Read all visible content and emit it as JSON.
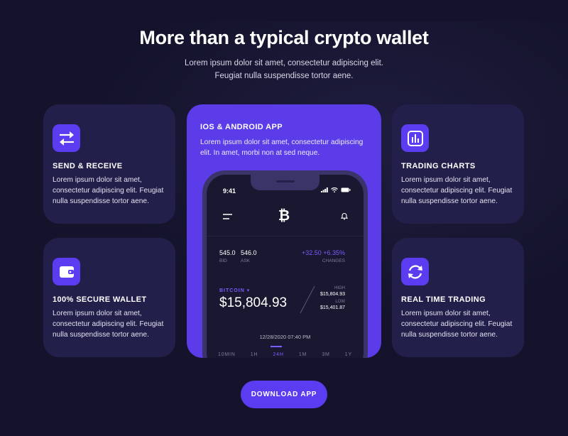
{
  "header": {
    "title": "More than a typical crypto wallet",
    "subtitle_line1": "Lorem ipsum dolor sit amet, consectetur adipiscing elit.",
    "subtitle_line2": "Feugiat nulla suspendisse tortor aene."
  },
  "features": {
    "send_receive": {
      "icon": "transfer-arrows-icon",
      "title": "SEND & RECEIVE",
      "text": "Lorem ipsum dolor sit amet, consectetur adipiscing elit. Feugiat nulla suspendisse tortor aene."
    },
    "secure_wallet": {
      "icon": "wallet-icon",
      "title": "100% SECURE WALLET",
      "text": "Lorem ipsum dolor sit amet, consectetur adipiscing elit. Feugiat nulla suspendisse tortor aene."
    },
    "trading_charts": {
      "icon": "bar-chart-icon",
      "title": "TRADING CHARTS",
      "text": "Lorem ipsum dolor sit amet, consectetur adipiscing elit. Feugiat nulla suspendisse tortor aene."
    },
    "real_time": {
      "icon": "refresh-icon",
      "title": "REAL TIME TRADING",
      "text": "Lorem ipsum dolor sit amet, consectetur adipiscing elit. Feugiat nulla suspendisse tortor aene."
    }
  },
  "app_card": {
    "title": "IOS & ANDROID APP",
    "text": "Lorem ipsum dolor sit amet, consectetur adipiscing elit. In amet, morbi non at sed neque."
  },
  "phone": {
    "time": "9:41",
    "bid_value": "545.0",
    "bid_label": "BID",
    "ask_value": "546.0",
    "ask_label": "ASK",
    "change_value": "+32.50  +6.35%",
    "change_label": "CHANGES",
    "coin_label": "BITCOIN",
    "price": "$15,804.93",
    "high_label": "HIGH",
    "high_value": "$15,804.93",
    "low_label": "LOW",
    "low_value": "$15,401.87",
    "date": "12/28/2020 07:40 PM",
    "ranges": [
      "10MIN",
      "1H",
      "24H",
      "1M",
      "3M",
      "1Y"
    ],
    "active_range": "24H"
  },
  "cta": {
    "label": "DOWNLOAD APP"
  },
  "colors": {
    "background": "#14132b",
    "card": "#22204a",
    "accent": "#5b3cf0",
    "accent_text": "#7a5cff"
  }
}
